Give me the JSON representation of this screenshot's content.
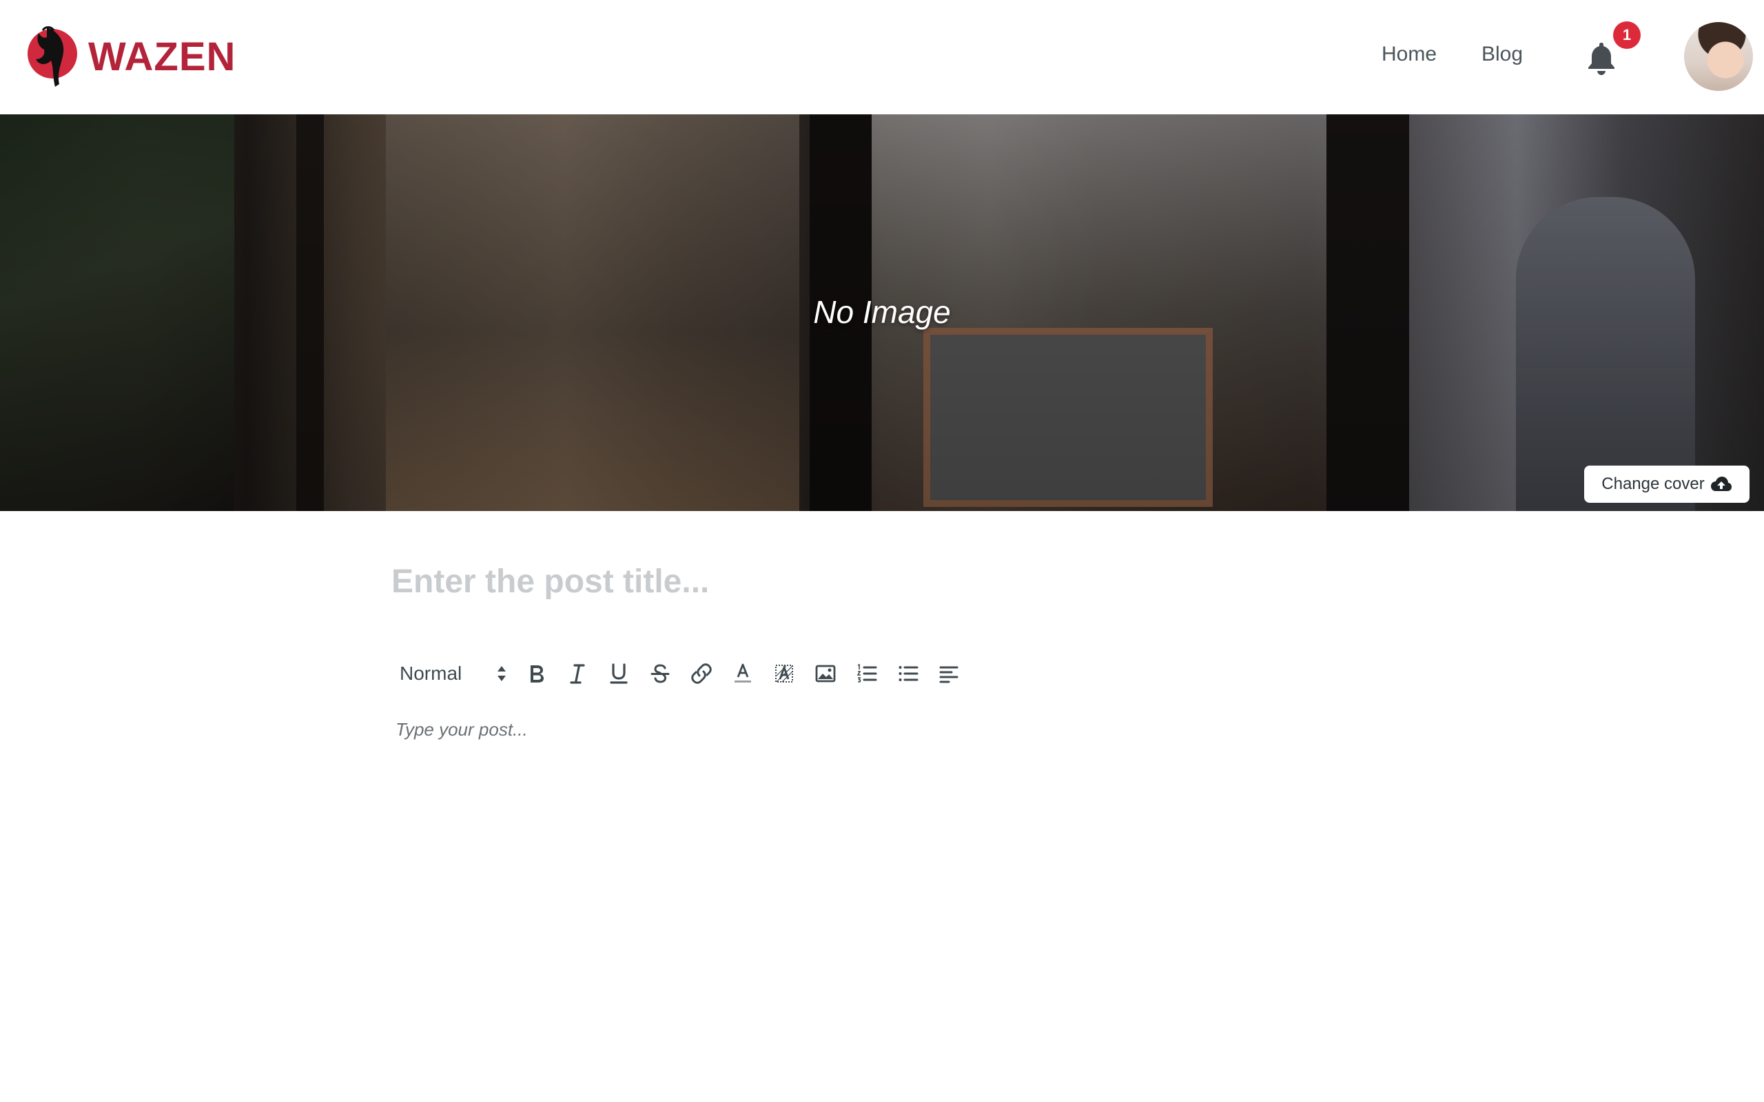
{
  "brand": {
    "name": "WAZEN",
    "color": "#b3243a"
  },
  "nav": {
    "home": "Home",
    "blog": "Blog",
    "notifications_count": "1"
  },
  "cover": {
    "placeholder_text": "No Image",
    "change_button_label": "Change cover"
  },
  "editor": {
    "title_placeholder": "Enter the post title...",
    "body_placeholder": "Type your post...",
    "format_select": {
      "selected": "Normal"
    },
    "toolbar_icons": [
      "bold-icon",
      "italic-icon",
      "underline-icon",
      "strikethrough-icon",
      "link-icon",
      "text-color-icon",
      "background-color-icon",
      "image-icon",
      "ordered-list-icon",
      "bullet-list-icon",
      "align-icon"
    ]
  },
  "colors": {
    "badge": "#dc2a3b",
    "text": "#3f4a4f",
    "placeholder": "#c9ccce"
  }
}
